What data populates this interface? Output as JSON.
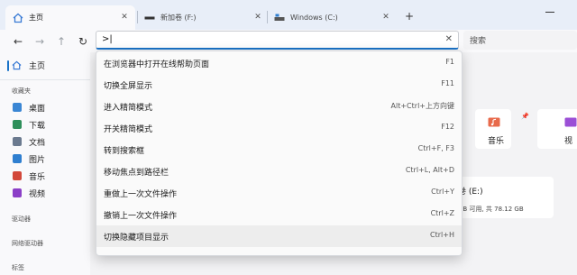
{
  "tabs": [
    {
      "label": "主页",
      "icon": "home-icon"
    },
    {
      "label": "新加卷 (F:)",
      "icon": "drive-icon"
    },
    {
      "label": "Windows (C:)",
      "icon": "windows-drive-icon"
    }
  ],
  "tab_close_glyph": "✕",
  "new_tab_glyph": "+",
  "nav": {
    "back": "←",
    "forward": "→",
    "up": "↑",
    "refresh": "↻"
  },
  "address": {
    "value": ">|",
    "clear_glyph": "✕"
  },
  "search": {
    "placeholder": "搜索"
  },
  "sidebar": {
    "home": "主页",
    "section_favorites": "收藏夹",
    "items": [
      {
        "label": "桌面",
        "icon": "desktop-icon",
        "color": "#3a86d4"
      },
      {
        "label": "下载",
        "icon": "download-icon",
        "color": "#2f8f5b"
      },
      {
        "label": "文档",
        "icon": "document-icon",
        "color": "#6b7a8f"
      },
      {
        "label": "图片",
        "icon": "pictures-icon",
        "color": "#2f7fd0"
      },
      {
        "label": "音乐",
        "icon": "music-icon",
        "color": "#d2473a"
      },
      {
        "label": "视频",
        "icon": "video-icon",
        "color": "#8b3fc7"
      }
    ],
    "section_drives": "驱动器",
    "section_network": "网络驱动器",
    "section_tags": "标签"
  },
  "quick_access": {
    "music_label": "音乐",
    "video_label_partial": "视",
    "pin_glyph": "📌"
  },
  "drive": {
    "name_partial": "卷 (E:)",
    "meta_partial": "GB 可用, 共 78.12 GB"
  },
  "command_menu": [
    {
      "label": "在浏览器中打开在线帮助页面",
      "shortcut": "F1"
    },
    {
      "label": "切换全屏显示",
      "shortcut": "F11"
    },
    {
      "label": "进入精简模式",
      "shortcut": "Alt+Ctrl+上方向键"
    },
    {
      "label": "开关精简模式",
      "shortcut": "F12"
    },
    {
      "label": "转到搜索框",
      "shortcut": "Ctrl+F, F3"
    },
    {
      "label": "移动焦点到路径栏",
      "shortcut": "Ctrl+L, Alt+D"
    },
    {
      "label": "重做上一次文件操作",
      "shortcut": "Ctrl+Y"
    },
    {
      "label": "撤销上一次文件操作",
      "shortcut": "Ctrl+Z"
    },
    {
      "label": "切换隐藏项目显示",
      "shortcut": "Ctrl+H",
      "highlighted": true
    }
  ],
  "colors": {
    "accent": "#1a73c8",
    "tabbar_bg": "#e8eef8",
    "menu_highlight": "#ededed"
  }
}
